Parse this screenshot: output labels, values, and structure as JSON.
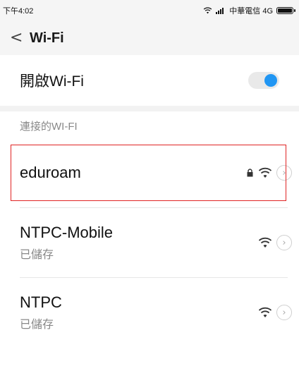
{
  "status_bar": {
    "time": "下午4:02",
    "carrier": "中華電信 4G"
  },
  "header": {
    "back_glyph": "<",
    "title": "Wi-Fi"
  },
  "wifi_toggle": {
    "label": "開啟Wi-Fi",
    "state": "on",
    "accent_color": "#2196f3"
  },
  "section": {
    "title": "連接的WI-FI"
  },
  "networks": [
    {
      "name": "eduroam",
      "subtitle": "",
      "secured": true,
      "selected": true
    },
    {
      "name": "NTPC-Mobile",
      "subtitle": "已儲存",
      "secured": false,
      "selected": false
    },
    {
      "name": "NTPC",
      "subtitle": "已儲存",
      "secured": false,
      "selected": false
    }
  ],
  "icons": {
    "detail": "chevron-right-circle-icon",
    "wifi": "wifi-signal-icon",
    "lock": "lock-icon"
  },
  "highlight_color": "#e02424"
}
